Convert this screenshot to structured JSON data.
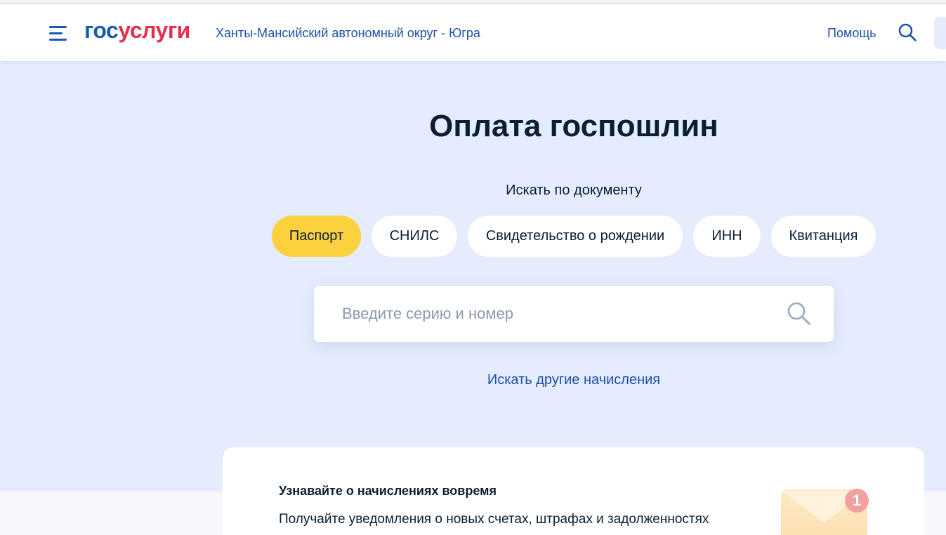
{
  "header": {
    "logo": {
      "part1": "гос",
      "part2": "услуги"
    },
    "region": "Ханты-Мансийский автономный округ - Югра",
    "help_link": "Помощь"
  },
  "main": {
    "title": "Оплата госпошлин",
    "search_by_label": "Искать по документу",
    "document_tabs": [
      {
        "label": "Паспорт",
        "selected": true
      },
      {
        "label": "СНИЛС",
        "selected": false
      },
      {
        "label": "Свидетельство о рождении",
        "selected": false
      },
      {
        "label": "ИНН",
        "selected": false
      },
      {
        "label": "Квитанция",
        "selected": false
      }
    ],
    "search": {
      "value": "",
      "placeholder": "Введите серию и номер"
    },
    "other_charges_link": "Искать другие начисления"
  },
  "notifications_card": {
    "title": "Узнавайте о начислениях вовремя",
    "text": "Получайте уведомления о новых счетах, штрафах и задолженностях",
    "badge_count": "1"
  },
  "icons": {
    "menu": "menu-icon",
    "header_search": "search-icon",
    "input_search": "search-icon",
    "notifications": "envelope-icon"
  },
  "colors": {
    "logo_blue": "#1a5bb0",
    "logo_red": "#e3304e",
    "link_blue": "#1d50a8",
    "page_bg": "#e4ecfd",
    "selected_tab": "#fbd13e",
    "text_dark": "#0b1f33",
    "placeholder": "#8d99ad",
    "input_icon": "#9aa9c4",
    "badge": "#f2a0a0",
    "bottom_bg": "#f6f8fb"
  }
}
